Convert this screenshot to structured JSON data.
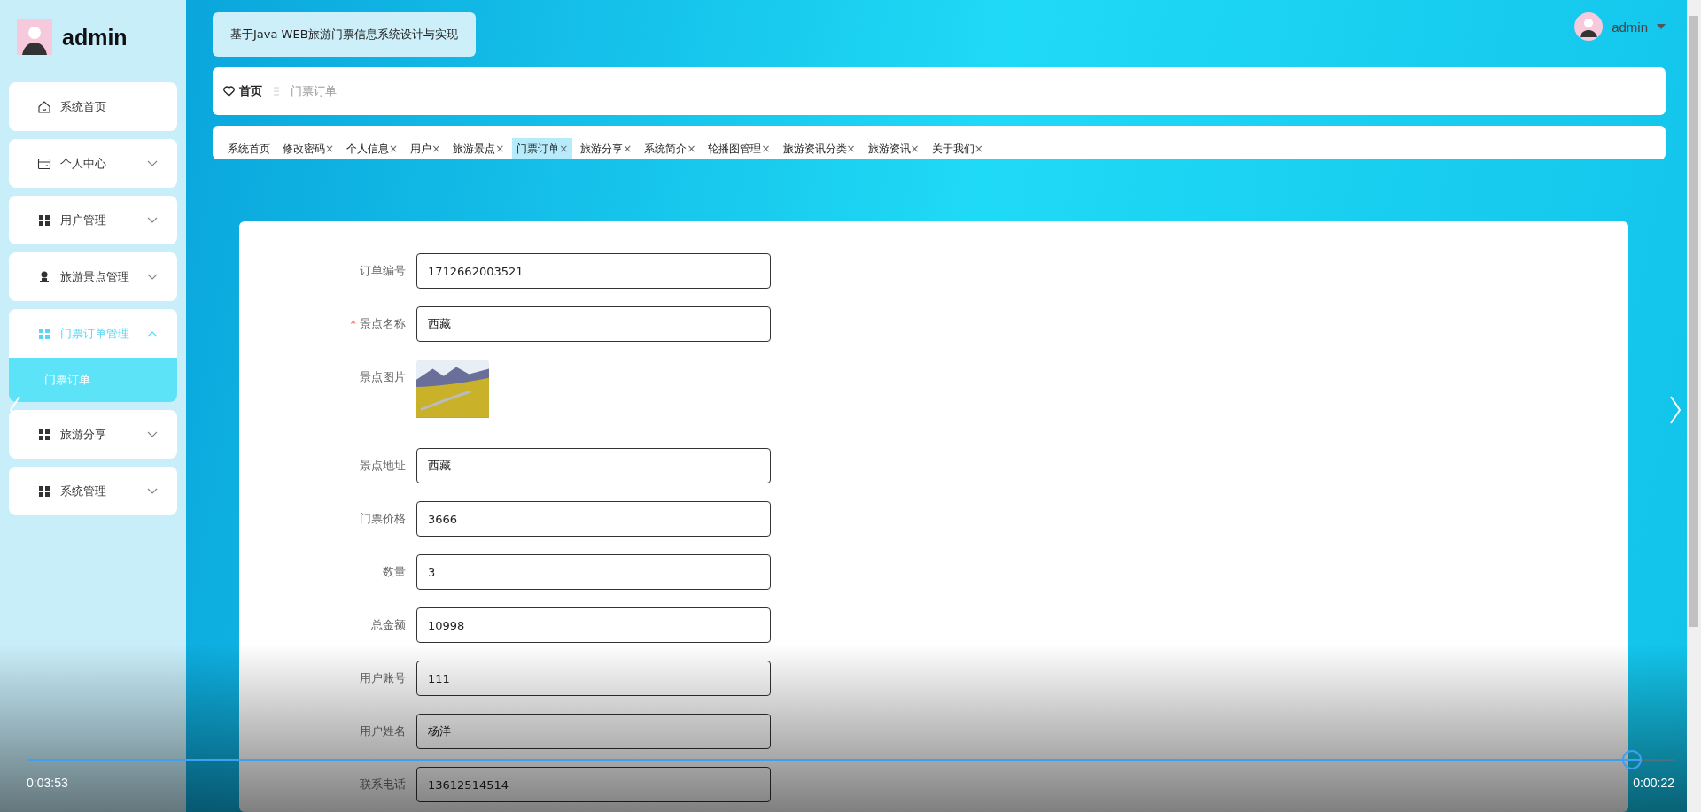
{
  "sidebar": {
    "user": "admin",
    "items": [
      {
        "label": "系统首页",
        "kind": "home",
        "selected": false
      },
      {
        "label": "个人中心",
        "kind": "card",
        "selected": false,
        "expanded": false
      },
      {
        "label": "用户管理",
        "kind": "grid",
        "selected": false,
        "expanded": false
      },
      {
        "label": "旅游景点管理",
        "kind": "person",
        "selected": false,
        "expanded": false
      },
      {
        "label": "门票订单管理",
        "kind": "grid",
        "selected": true,
        "expanded": true,
        "children": [
          {
            "label": "门票订单",
            "selected": true
          }
        ]
      },
      {
        "label": "旅游分享",
        "kind": "grid",
        "selected": false,
        "expanded": false
      },
      {
        "label": "系统管理",
        "kind": "grid",
        "selected": false,
        "expanded": false
      }
    ]
  },
  "header": {
    "title": "基于Java WEB旅游门票信息系统设计与实现",
    "user_menu": "admin"
  },
  "breadcrumb": [
    {
      "label": "首页",
      "current": false
    },
    {
      "label": "门票订单",
      "current": true
    }
  ],
  "tabs": [
    {
      "label": "系统首页",
      "selected": false,
      "closable": false
    },
    {
      "label": "修改密码",
      "selected": false,
      "closable": true
    },
    {
      "label": "个人信息",
      "selected": false,
      "closable": true
    },
    {
      "label": "用户",
      "selected": false,
      "closable": true
    },
    {
      "label": "旅游景点",
      "selected": false,
      "closable": true
    },
    {
      "label": "门票订单",
      "selected": true,
      "closable": true
    },
    {
      "label": "旅游分享",
      "selected": false,
      "closable": true
    },
    {
      "label": "系统简介",
      "selected": false,
      "closable": true
    },
    {
      "label": "轮播图管理",
      "selected": false,
      "closable": true
    },
    {
      "label": "旅游资讯分类",
      "selected": false,
      "closable": true
    },
    {
      "label": "旅游资讯",
      "selected": false,
      "closable": true
    },
    {
      "label": "关于我们",
      "selected": false,
      "closable": true
    }
  ],
  "close_glyph": "×",
  "form": [
    {
      "label": "订单编号",
      "kind": "text",
      "required": false,
      "value": "1712662003521"
    },
    {
      "label": "景点名称",
      "kind": "text",
      "required": true,
      "value": "西藏"
    },
    {
      "label": "景点图片",
      "kind": "image",
      "required": false
    },
    {
      "label": "景点地址",
      "kind": "text",
      "required": false,
      "value": "西藏"
    },
    {
      "label": "门票价格",
      "kind": "text",
      "required": false,
      "value": "3666"
    },
    {
      "label": "数量",
      "kind": "text",
      "required": false,
      "value": "3"
    },
    {
      "label": "总金额",
      "kind": "text",
      "required": false,
      "value": "10998"
    },
    {
      "label": "用户账号",
      "kind": "text",
      "required": false,
      "value": "111"
    },
    {
      "label": "用户姓名",
      "kind": "text",
      "required": false,
      "value": "杨洋"
    },
    {
      "label": "联系电话",
      "kind": "text",
      "required": false,
      "value": "13612514514"
    }
  ],
  "required_mark": "*",
  "video_player": {
    "elapsed": "0:03:53",
    "remaining": "0:00:22",
    "level": 0.98
  }
}
